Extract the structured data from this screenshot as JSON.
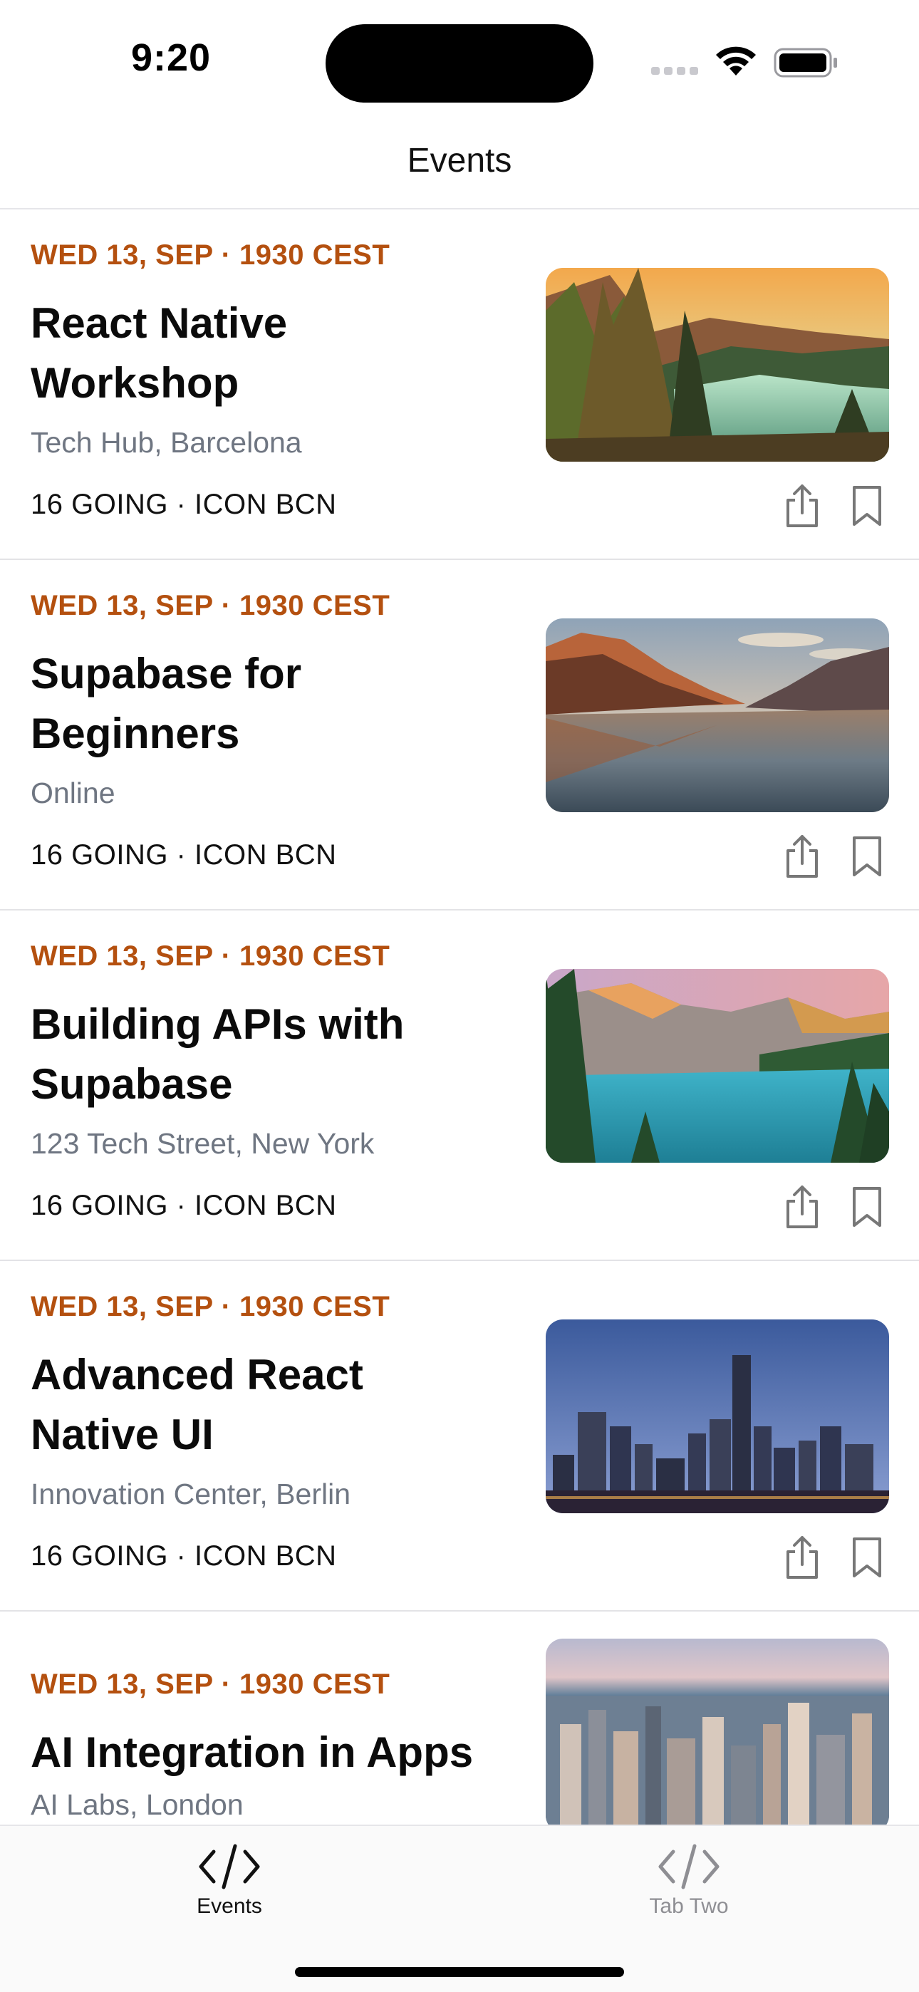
{
  "status_bar": {
    "time": "9:20"
  },
  "header": {
    "title": "Events"
  },
  "events": [
    {
      "date": "WED 13, SEP · 1930 CEST",
      "title": "React Native Workshop",
      "location": "Tech Hub, Barcelona",
      "meta": "16 GOING · ICON BCN",
      "image": "forest-lake-sunset"
    },
    {
      "date": "WED 13, SEP · 1930 CEST",
      "title": "Supabase for Beginners",
      "location": "Online",
      "meta": "16 GOING · ICON BCN",
      "image": "mountain-lake-reflection"
    },
    {
      "date": "WED 13, SEP · 1930 CEST",
      "title": "Building APIs with Supabase",
      "location": "123 Tech Street, New York",
      "meta": "16 GOING · ICON BCN",
      "image": "turquoise-mountain-lake"
    },
    {
      "date": "WED 13, SEP · 1930 CEST",
      "title": "Advanced React Native UI",
      "location": "Innovation Center, Berlin",
      "meta": "16 GOING · ICON BCN",
      "image": "city-skyline-dusk"
    },
    {
      "date": "WED 13, SEP · 1930 CEST",
      "title": "AI Integration in Apps",
      "location": "AI Labs, London",
      "meta": "",
      "image": "aerial-city-skyline"
    }
  ],
  "tabs": [
    {
      "label": "Events",
      "icon": "code-icon",
      "active": true
    },
    {
      "label": "Tab Two",
      "icon": "code-icon",
      "active": false
    }
  ],
  "colors": {
    "date_accent": "#b4500f",
    "location_gray": "#6f7682",
    "divider": "#e3e3e6",
    "inactive_tab": "#8e8e93"
  }
}
